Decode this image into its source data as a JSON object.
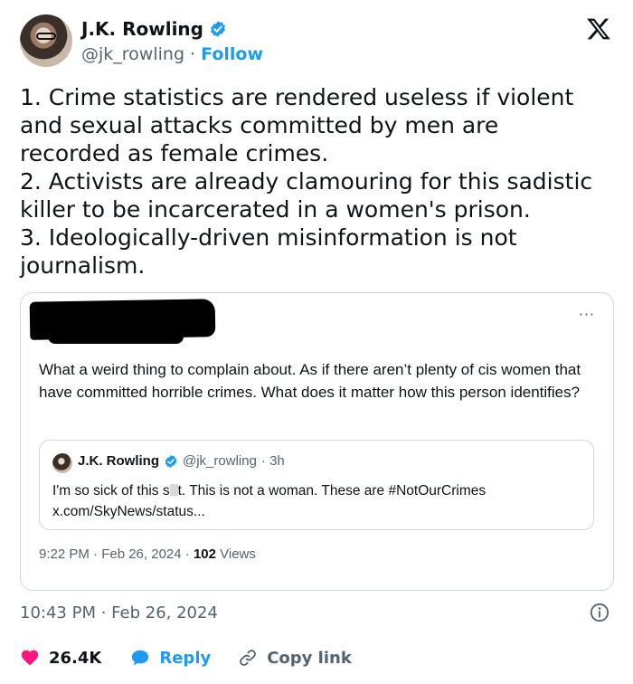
{
  "author": {
    "name": "J.K. Rowling",
    "handle": "@jk_rowling",
    "separator": "·",
    "follow_label": "Follow"
  },
  "tweet": {
    "text": "1. Crime statistics are rendered useless if violent\nand sexual attacks committed by men are\nrecorded as female crimes.\n2. Activists are already clamouring for this sadistic\nkiller to be incarcerated in a women's prison.\n3. Ideologically-driven misinformation is not\njournalism.",
    "timestamp": "10:43 PM · Feb 26, 2024"
  },
  "embedded_reply": {
    "more_label": "···",
    "text": "What a weird thing to complain about. As if there aren’t plenty of cis women that have committed horrible crimes. What does it matter how this person identifies?",
    "quote": {
      "name": "J.K. Rowling",
      "handle": "@jk_rowling",
      "time": "· 3h",
      "text_before": "I'm so sick of this s",
      "text_after": "t. This is not a woman. These are #NotOurCrimes",
      "link": "x.com/SkyNews/status..."
    },
    "footer_time": "9:22 PM · Feb 26, 2024 ·",
    "views_count": "102",
    "views_label": "Views"
  },
  "actions": {
    "likes": "26.4K",
    "reply_label": "Reply",
    "copy_label": "Copy link"
  },
  "colors": {
    "accent": "#1d9bf0",
    "like": "#f91880",
    "muted": "#536471"
  }
}
